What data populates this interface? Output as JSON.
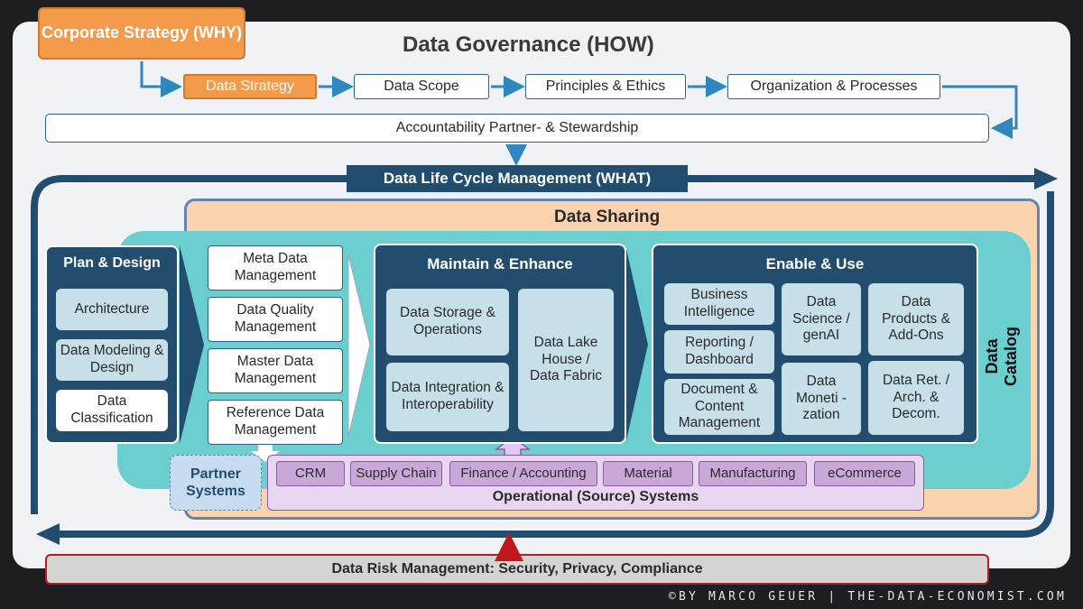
{
  "corporate_strategy": "Corporate Strategy (WHY)",
  "governance_title": "Data Governance (HOW)",
  "governance_steps": [
    "Data Strategy",
    "Data Scope",
    "Principles & Ethics",
    "Organization & Processes"
  ],
  "accountability": "Accountability Partner- & Stewardship",
  "lifecycle_title": "Data Life Cycle Management (WHAT)",
  "data_sharing": "Data Sharing",
  "data_catalog": "Data Catalog",
  "plan_design": {
    "title": "Plan & Design",
    "items": [
      "Architecture",
      "Data Modeling & Design",
      "Data Classification"
    ]
  },
  "management": [
    "Meta Data Management",
    "Data Quality Management",
    "Master Data Management",
    "Reference Data Management"
  ],
  "maintain": {
    "title": "Maintain & Enhance",
    "items": [
      "Data Storage & Operations",
      "Data Integration & Interoperability",
      "Data Lake House / Data Fabric"
    ]
  },
  "enable": {
    "title": "Enable & Use",
    "items": [
      "Business Intelligence",
      "Reporting / Dashboard",
      "Document & Content Management",
      "Data Science / genAI",
      "Data Moneti -zation",
      "Data Products & Add-Ons",
      "Data Ret. / Arch. & Decom."
    ]
  },
  "partner_systems": "Partner Systems",
  "operational": {
    "title": "Operational (Source) Systems",
    "systems": [
      "CRM",
      "Supply Chain",
      "Finance / Accounting",
      "Material",
      "Manufacturing",
      "eCommerce"
    ]
  },
  "risk": "Data Risk Management: Security, Privacy, Compliance",
  "footer": "©BY MARCO GEUER | THE-DATA-ECONOMIST.COM",
  "colors": {
    "navy": "#234d6e",
    "teal": "#6ccfcf",
    "orange": "#f39a4b",
    "peach": "#fbd3ae",
    "purple": "#c9a8d8",
    "risk_border": "#c0181b"
  }
}
